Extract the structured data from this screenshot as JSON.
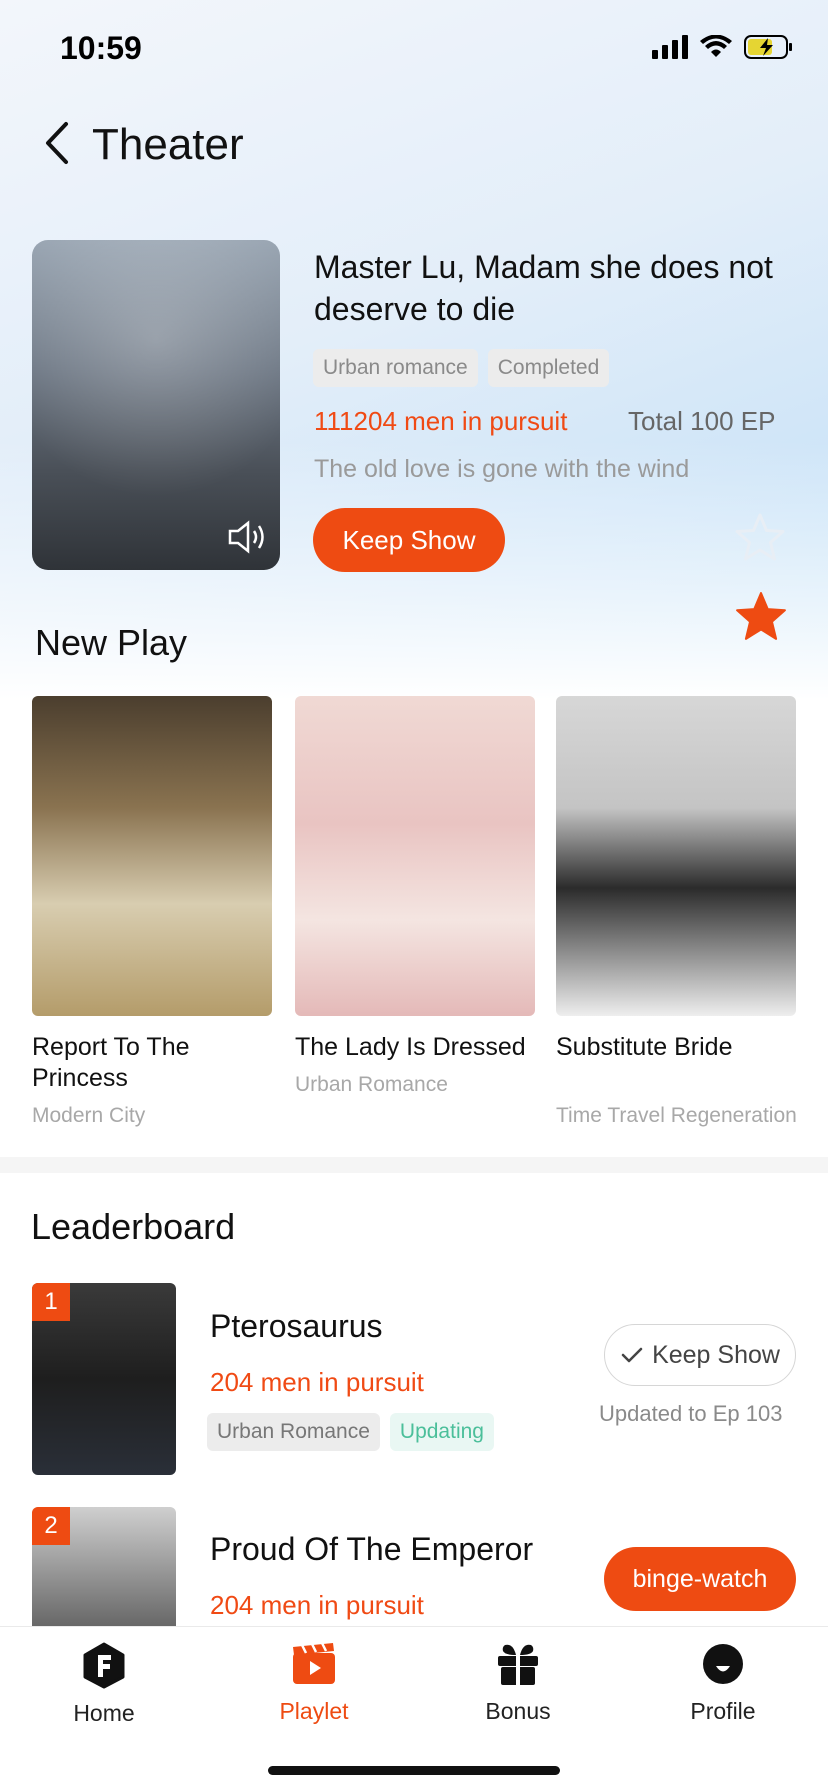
{
  "status_bar": {
    "time": "10:59"
  },
  "header": {
    "title": "Theater"
  },
  "featured": {
    "title": "Master Lu, Madam she does not deserve to die",
    "tags": [
      "Urban romance",
      "Completed"
    ],
    "pursuit": "111204 men in pursuit",
    "total": "Total 100 EP",
    "description": "The old love is gone with the wind",
    "button": "Keep Show"
  },
  "new_play": {
    "title": "New Play",
    "items": [
      {
        "title": "Report To The Princess",
        "genre": "Modern City"
      },
      {
        "title": "The Lady Is Dressed",
        "genre": "Urban Romance"
      },
      {
        "title": "Substitute Bride",
        "genre": "Time Travel Regeneration"
      }
    ]
  },
  "leaderboard": {
    "title": "Leaderboard",
    "items": [
      {
        "rank": "1",
        "title": "Pterosaurus",
        "pursuit": "204 men in pursuit",
        "tags": [
          "Urban Romance",
          "Updating"
        ],
        "button": "Keep Show",
        "updated": "Updated to Ep 103"
      },
      {
        "rank": "2",
        "title": "Proud Of The Emperor",
        "pursuit": "204 men in pursuit",
        "button": "binge-watch"
      }
    ]
  },
  "nav": {
    "items": [
      {
        "label": "Home",
        "icon": "home-icon"
      },
      {
        "label": "Playlet",
        "icon": "playlet-icon",
        "active": true
      },
      {
        "label": "Bonus",
        "icon": "gift-icon"
      },
      {
        "label": "Profile",
        "icon": "profile-icon"
      }
    ]
  },
  "colors": {
    "accent": "#ee4b12",
    "green": "#4bbf9a"
  }
}
